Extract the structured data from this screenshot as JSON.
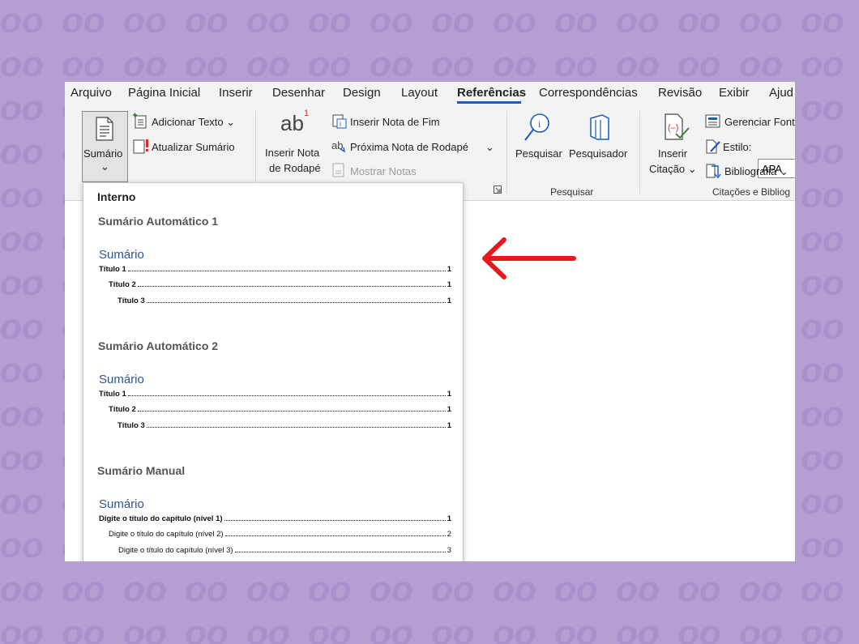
{
  "tabs": [
    "Arquivo",
    "Página Inicial",
    "Inserir",
    "Desenhar",
    "Design",
    "Layout",
    "Referências",
    "Correspondências",
    "Revisão",
    "Exibir",
    "Ajud"
  ],
  "active_tab": "Referências",
  "ribbon": {
    "sumario": {
      "line1": "Sumário",
      "chevron": "⌄"
    },
    "adicionar_texto": "Adicionar Texto ⌄",
    "atualizar_sumario": "Atualizar Sumário",
    "inserir_nota_line1": "Inserir Nota",
    "inserir_nota_line2": "de Rodapé",
    "ab_glyph": "ab",
    "ab_sup": "1",
    "inserir_nota_fim": "Inserir Nota de Fim",
    "proxima_nota": "Próxima Nota de Rodapé",
    "proxima_chevron": "⌄",
    "mostrar_notas": "Mostrar Notas",
    "pesquisar": "Pesquisar",
    "pesquisador": "Pesquisador",
    "group_pesquisar": "Pesquisar",
    "inserir_citacao_line1": "Inserir",
    "inserir_citacao_line2": "Citação ⌄",
    "gerenciar_fontes": "Gerenciar Font",
    "estilo_label": "Estilo:",
    "estilo_value": "APA",
    "bibliografia": "Bibliografia ⌄",
    "group_citacoes": "Citações e Bibliog"
  },
  "dropdown": {
    "header": "Interno",
    "sections": [
      {
        "name": "Sumário Automático 1",
        "title": "Sumário",
        "lines": [
          {
            "text": "Título 1",
            "page": "1"
          },
          {
            "text": "Título 2",
            "page": "1"
          },
          {
            "text": "Título 3",
            "page": "1"
          }
        ]
      },
      {
        "name": "Sumário Automático 2",
        "title": "Sumário",
        "lines": [
          {
            "text": "Título 1",
            "page": "1"
          },
          {
            "text": "Título 2",
            "page": "1"
          },
          {
            "text": "Título 3",
            "page": "1"
          }
        ]
      },
      {
        "name": "Sumário Manual",
        "title": "Sumário",
        "lines": [
          {
            "text": "Digite o título do capítulo (nível 1)",
            "page": "1"
          },
          {
            "text": "Digite o título do capítulo (nível 2)",
            "page": "2"
          },
          {
            "text": "Digite o título do capítulo (nível 3)",
            "page": "3"
          }
        ]
      }
    ]
  },
  "colors": {
    "background": "#b39fd2",
    "accent": "#185abd",
    "arrow": "#e8191c",
    "sumario_heading": "#2f5496"
  },
  "icons": [
    "sumario-doc-icon",
    "adicionar-texto-icon",
    "atualizar-sumario-icon",
    "inserir-nota-fim-icon",
    "proxima-nota-icon",
    "mostrar-notas-icon",
    "pesquisar-icon",
    "pesquisador-icon",
    "inserir-citacao-icon",
    "gerenciar-fontes-icon",
    "estilo-icon",
    "bibliografia-icon",
    "dialog-launcher-icon",
    "red-arrow-icon"
  ]
}
